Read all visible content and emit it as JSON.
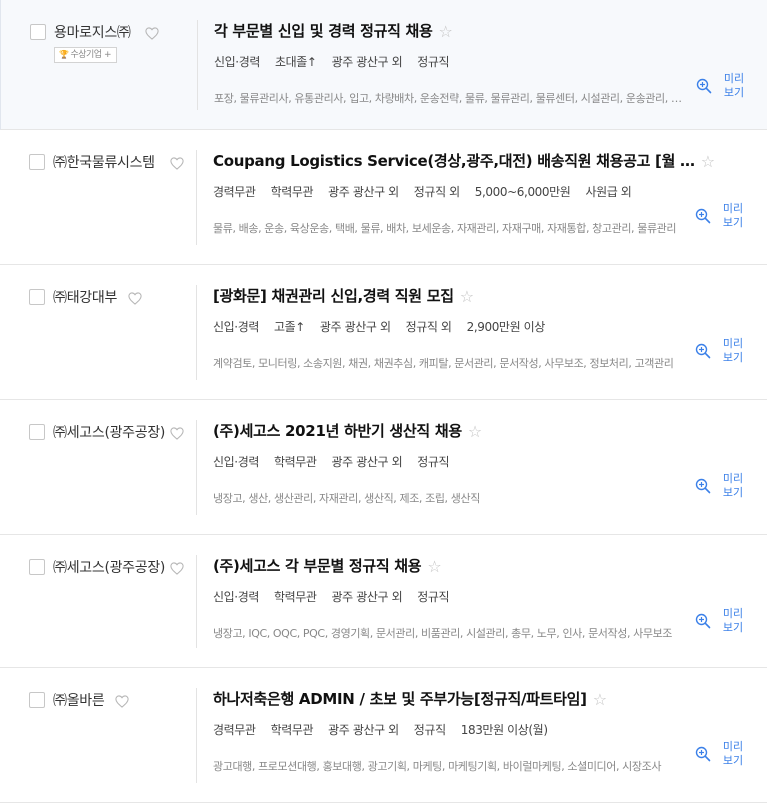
{
  "preview_label": "미리보기",
  "jobs": [
    {
      "company": "용마로지스㈜",
      "badge": "수상기업",
      "title": "각 부문별 신입 및 경력 정규직 채용",
      "conditions": [
        "신입·경력",
        "초대졸↑",
        "광주 광산구 외",
        "정규직"
      ],
      "tags": "포장, 물류관리사, 유통관리사, 입고, 차량배차, 운송전략, 물류, 물류관리, 물류센터, 시설관리, 운송관리, 배송",
      "highlight": true
    },
    {
      "company": "㈜한국물류시스템",
      "badge": "",
      "title": "Coupang Logistics Service(경상,광주,대전) 배송직원 채용공고 [월 …",
      "conditions": [
        "경력무관",
        "학력무관",
        "광주 광산구 외",
        "정규직 외",
        "5,000~6,000만원",
        "사원급 외"
      ],
      "tags": "물류, 배송, 운송, 육상운송, 택배, 물류, 배차, 보세운송, 자재관리, 자재구매, 자재통합, 창고관리, 물류관리",
      "highlight": false
    },
    {
      "company": "㈜태강대부",
      "badge": "",
      "title": "[광화문] 채권관리 신입,경력 직원 모집",
      "conditions": [
        "신입·경력",
        "고졸↑",
        "광주 광산구 외",
        "정규직 외",
        "2,900만원 이상"
      ],
      "tags": "계약검토, 모니터링, 소송지원, 채권, 채권추심, 캐피탈, 문서관리, 문서작성, 사무보조, 정보처리, 고객관리",
      "highlight": false
    },
    {
      "company": "㈜세고스(광주공장)",
      "badge": "",
      "title": "(주)세고스 2021년 하반기 생산직 채용",
      "conditions": [
        "신입·경력",
        "학력무관",
        "광주 광산구 외",
        "정규직"
      ],
      "tags": "냉장고, 생산, 생산관리, 자재관리, 생산직, 제조, 조립, 생산직",
      "highlight": false
    },
    {
      "company": "㈜세고스(광주공장)",
      "badge": "",
      "title": "(주)세고스 각 부문별 정규직 채용",
      "conditions": [
        "신입·경력",
        "학력무관",
        "광주 광산구 외",
        "정규직"
      ],
      "tags": "냉장고, IQC, OQC, PQC, 경영기획, 문서관리, 비품관리, 시설관리, 총무, 노무, 인사, 문서작성, 사무보조",
      "highlight": false
    },
    {
      "company": "㈜올바른",
      "badge": "",
      "title": "하나저축은행 ADMIN / 초보 및 주부가능[정규직/파트타임]",
      "conditions": [
        "경력무관",
        "학력무관",
        "광주 광산구 외",
        "정규직",
        "183만원 이상(월)"
      ],
      "tags": "광고대행, 프로모션대행, 홍보대행, 광고기획, 마케팅, 마케팅기획, 바이럴마케팅, 소셜미디어, 시장조사",
      "highlight": false
    }
  ]
}
